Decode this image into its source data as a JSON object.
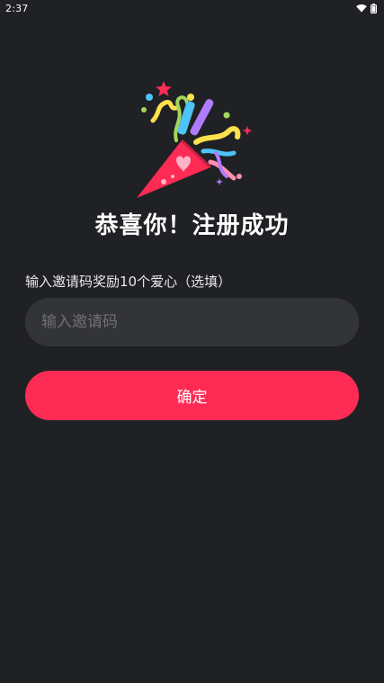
{
  "status_bar": {
    "time": "2:37",
    "icons": [
      "wifi-icon",
      "battery-icon"
    ]
  },
  "illustration": {
    "icon": "party-popper-icon",
    "colors": {
      "cone": "#fe2c55",
      "heart": "#ffb3c6",
      "yellow": "#ffe14d",
      "cyan": "#4fc3f7",
      "green": "#a5d65a",
      "pink": "#ff8fb1",
      "purple": "#b07cff"
    }
  },
  "main": {
    "title": "恭喜你！注册成功",
    "invite_label": "输入邀请码奖励10个爱心（选填）",
    "invite_input": {
      "placeholder": "输入邀请码",
      "value": ""
    },
    "confirm_label": "确定"
  },
  "colors": {
    "background": "#202124",
    "input_background": "#333438",
    "accent": "#fe2c55"
  }
}
